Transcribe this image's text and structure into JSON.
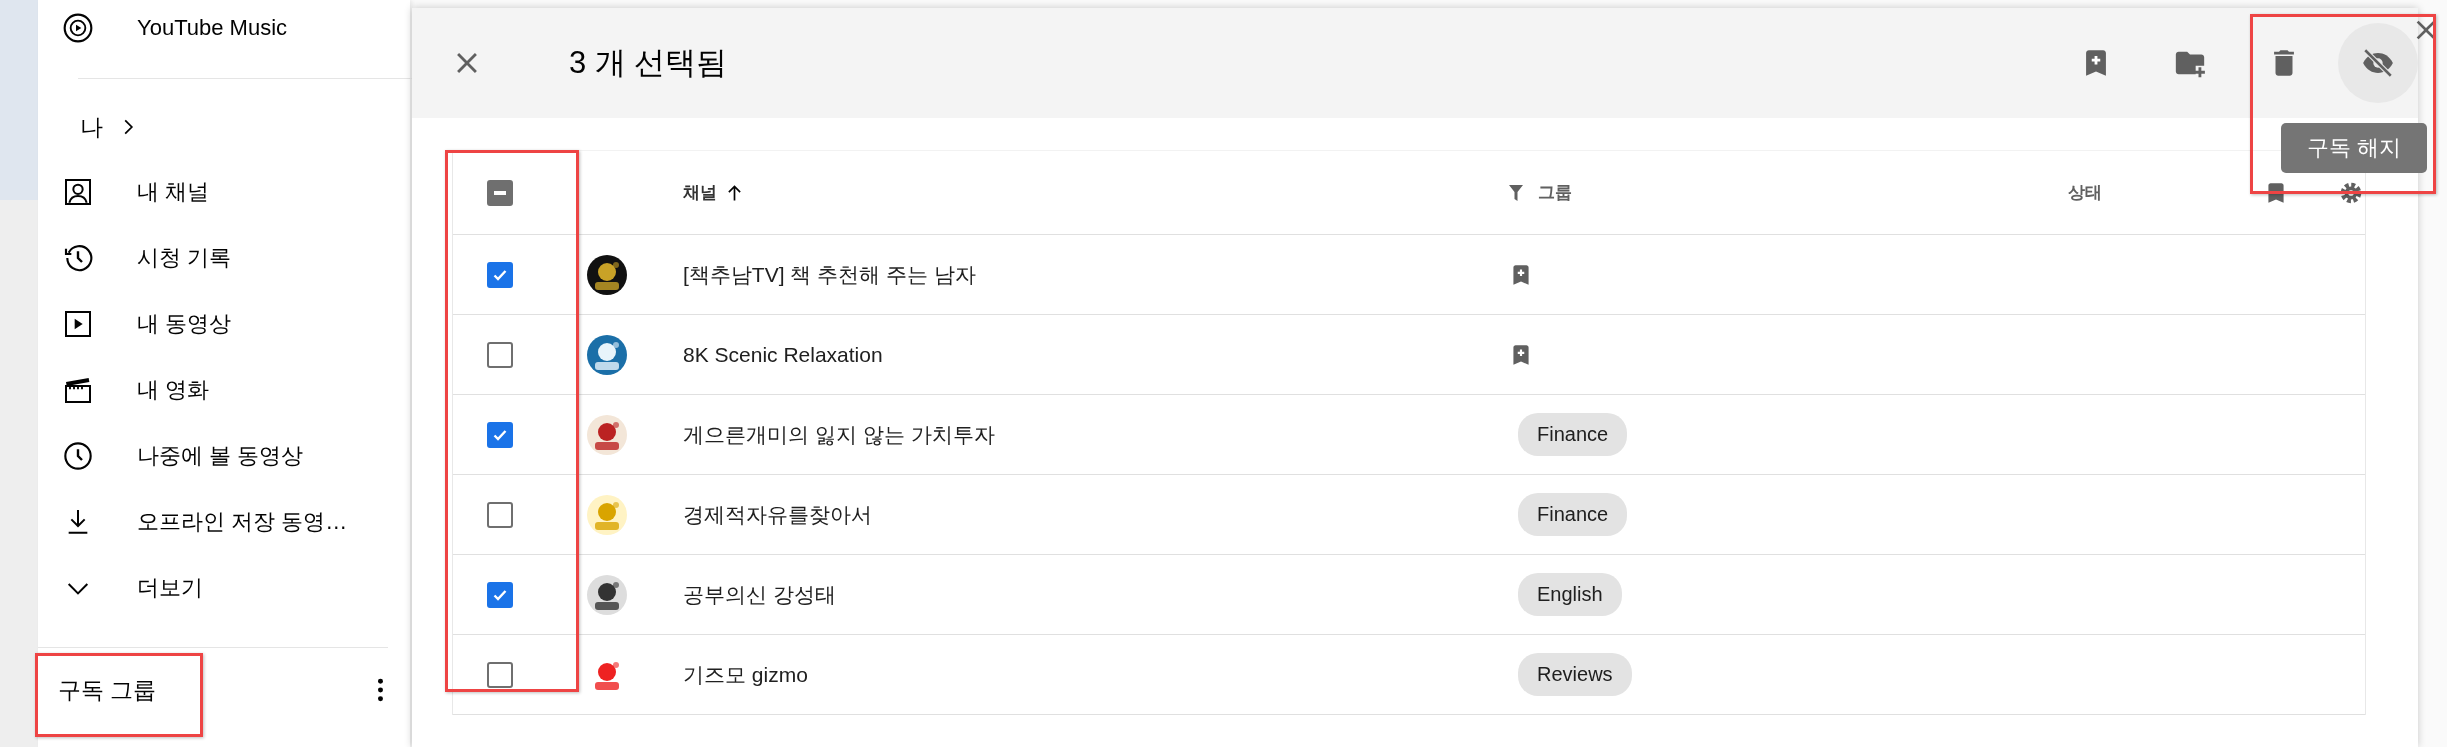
{
  "sidebar": {
    "top_item": {
      "label": "YouTube Music"
    },
    "section": {
      "label": "나"
    },
    "items": [
      {
        "label": "내 채널",
        "kind": "channel"
      },
      {
        "label": "시청 기록",
        "kind": "history"
      },
      {
        "label": "내 동영상",
        "kind": "videos"
      },
      {
        "label": "내 영화",
        "kind": "movies"
      },
      {
        "label": "나중에 볼 동영상",
        "kind": "later"
      },
      {
        "label": "오프라인 저장 동영…",
        "kind": "download"
      },
      {
        "label": "더보기",
        "kind": "more"
      }
    ],
    "footer": {
      "label": "구독 그룹"
    }
  },
  "dialog": {
    "title": "3 개 선택됨",
    "tooltip": "구독 해지",
    "actions": [
      {
        "kind": "bookmark-add",
        "selected": false
      },
      {
        "kind": "folder-add",
        "selected": false
      },
      {
        "kind": "delete",
        "selected": false
      },
      {
        "kind": "hide",
        "selected": true
      }
    ]
  },
  "table": {
    "select_all": {
      "indeterminate": true
    },
    "channel_column": "채널",
    "group_column": "그룹",
    "status_column": "상태",
    "rows": [
      {
        "name": "[책추남TV] 책 추천해 주는 남자",
        "checked": true
      },
      {
        "name": "8K Scenic Relaxation",
        "checked": false
      },
      {
        "name": "게으른개미의 잃지 않는 가치투자",
        "checked": true,
        "group": "Finance"
      },
      {
        "name": "경제적자유를찾아서",
        "checked": false,
        "group": "Finance"
      },
      {
        "name": "공부의신 강성태",
        "checked": true,
        "group": "English"
      },
      {
        "name": "기즈모 gizmo",
        "checked": false,
        "group": "Reviews"
      }
    ]
  },
  "highlights": [
    {
      "kind": "checkbox-column"
    },
    {
      "kind": "unsubscribe"
    },
    {
      "kind": "group-label"
    }
  ]
}
